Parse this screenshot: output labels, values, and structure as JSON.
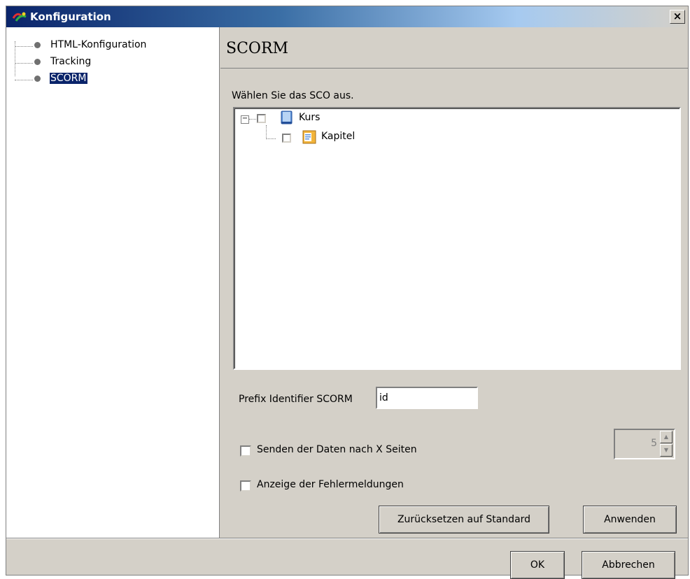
{
  "window": {
    "title": "Konfiguration",
    "close_glyph": "×",
    "app_icon": "app-logo-icon",
    "title_gradient_start": "#0a246a"
  },
  "nav": {
    "items": [
      {
        "label": "HTML-Konfiguration",
        "selected": false
      },
      {
        "label": "Tracking",
        "selected": false
      },
      {
        "label": "SCORM",
        "selected": true
      }
    ]
  },
  "section": {
    "title": "SCORM",
    "instruction": "Wählen Sie das SCO aus."
  },
  "sco_tree": {
    "expander_glyph": "−",
    "nodes": [
      {
        "label": "Kurs",
        "icon": "book-icon",
        "checked": false
      },
      {
        "label": "Kapitel",
        "icon": "chapter-icon",
        "checked": false
      }
    ]
  },
  "form": {
    "prefix_label": "Prefix Identifier SCORM",
    "prefix_value": "id",
    "send_data_label": "Senden der Daten nach X Seiten",
    "send_data_checked": false,
    "pages_value": "5",
    "show_errors_label": "Anzeige der  Fehlermeldungen",
    "show_errors_checked": false
  },
  "buttons": {
    "reset": "Zurücksetzen auf Standard",
    "apply": "Anwenden",
    "ok": "OK",
    "cancel": "Abbrechen"
  },
  "colors": {
    "selection": "#0a246a",
    "dialog_bg": "#d4d0c8"
  }
}
